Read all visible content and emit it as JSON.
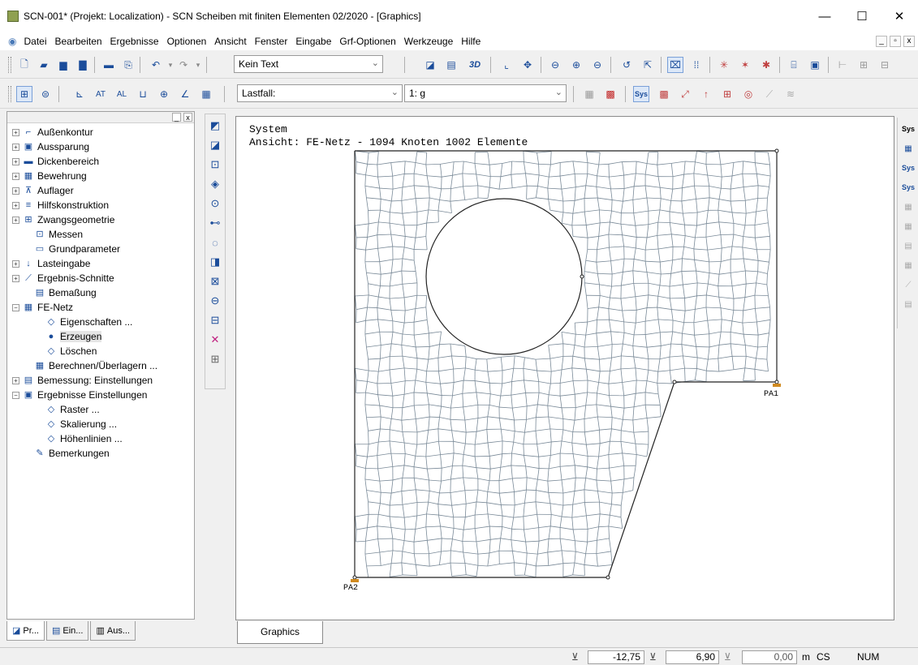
{
  "window": {
    "title": "SCN-001* (Projekt: Localization) - SCN Scheiben mit finiten Elementen 02/2020 - [Graphics]",
    "minimize": "—",
    "maximize": "☐",
    "close": "✕"
  },
  "menu": [
    "Datei",
    "Bearbeiten",
    "Ergebnisse",
    "Optionen",
    "Ansicht",
    "Fenster",
    "Eingabe",
    "Grf-Optionen",
    "Werkzeuge",
    "Hilfe"
  ],
  "mdi_controls": [
    "_",
    "▫",
    "x"
  ],
  "toolbar1": {
    "text_combo": "Kein Text",
    "label_3d": "3D"
  },
  "toolbar2": {
    "loadcase_label": "Lastfall:",
    "loadcase_value": "1: g"
  },
  "tree": [
    {
      "label": "Außenkontur",
      "expander": "+",
      "icon": "⌐"
    },
    {
      "label": "Aussparung",
      "expander": "+",
      "icon": "▣"
    },
    {
      "label": "Dickenbereich",
      "expander": "+",
      "icon": "▬"
    },
    {
      "label": "Bewehrung",
      "expander": "+",
      "icon": "▦"
    },
    {
      "label": "Auflager",
      "expander": "+",
      "icon": "⊼"
    },
    {
      "label": "Hilfskonstruktion",
      "expander": "+",
      "icon": "≡"
    },
    {
      "label": "Zwangsgeometrie",
      "expander": "+",
      "icon": "⊞"
    },
    {
      "label": "Messen",
      "expander": "",
      "icon": "⊡"
    },
    {
      "label": "Grundparameter",
      "expander": "",
      "icon": "▭"
    },
    {
      "label": "Lasteingabe",
      "expander": "+",
      "icon": "↓"
    },
    {
      "label": "Ergebnis-Schnitte",
      "expander": "+",
      "icon": "⟋"
    },
    {
      "label": "Bemaßung",
      "expander": "",
      "icon": "▤"
    },
    {
      "label": "FE-Netz",
      "expander": "−",
      "icon": "▦"
    },
    {
      "label": "Eigenschaften ...",
      "expander": "",
      "icon": "◇"
    },
    {
      "label": "Erzeugen",
      "expander": "",
      "icon": "●"
    },
    {
      "label": "Löschen",
      "expander": "",
      "icon": "◇"
    },
    {
      "label": "Berechnen/Überlagern ...",
      "expander": "",
      "icon": "▦"
    },
    {
      "label": "Bemessung: Einstellungen",
      "expander": "+",
      "icon": "▤"
    },
    {
      "label": "Ergebnisse Einstellungen",
      "expander": "−",
      "icon": "▣"
    },
    {
      "label": "Raster ...",
      "expander": "",
      "icon": "◇"
    },
    {
      "label": "Skalierung ...",
      "expander": "",
      "icon": "◇"
    },
    {
      "label": "Höhenlinien ...",
      "expander": "",
      "icon": "◇"
    },
    {
      "label": "Bemerkungen",
      "expander": "",
      "icon": "✎"
    }
  ],
  "panel_tabs": [
    "Pr...",
    "Ein...",
    "Aus..."
  ],
  "graphics": {
    "line1": "System",
    "line2": "Ansicht: FE-Netz - 1094 Knoten 1002 Elemente",
    "support_left": "PA2",
    "support_right": "PA1",
    "tab_label": "Graphics"
  },
  "right_toolbar": [
    "Sys",
    "▦",
    "Sys",
    "Sys",
    "▦",
    "▦",
    "▤",
    "▦",
    "⟋",
    "▤"
  ],
  "status": {
    "x_value": "-12,75",
    "y_value": "6,90",
    "z_value": "0,00",
    "unit": "m",
    "cs": "CS",
    "num": "NUM"
  },
  "colors": {
    "mesh": "#7a8a98",
    "accent": "#1a4c9a",
    "support": "#d08a20"
  }
}
